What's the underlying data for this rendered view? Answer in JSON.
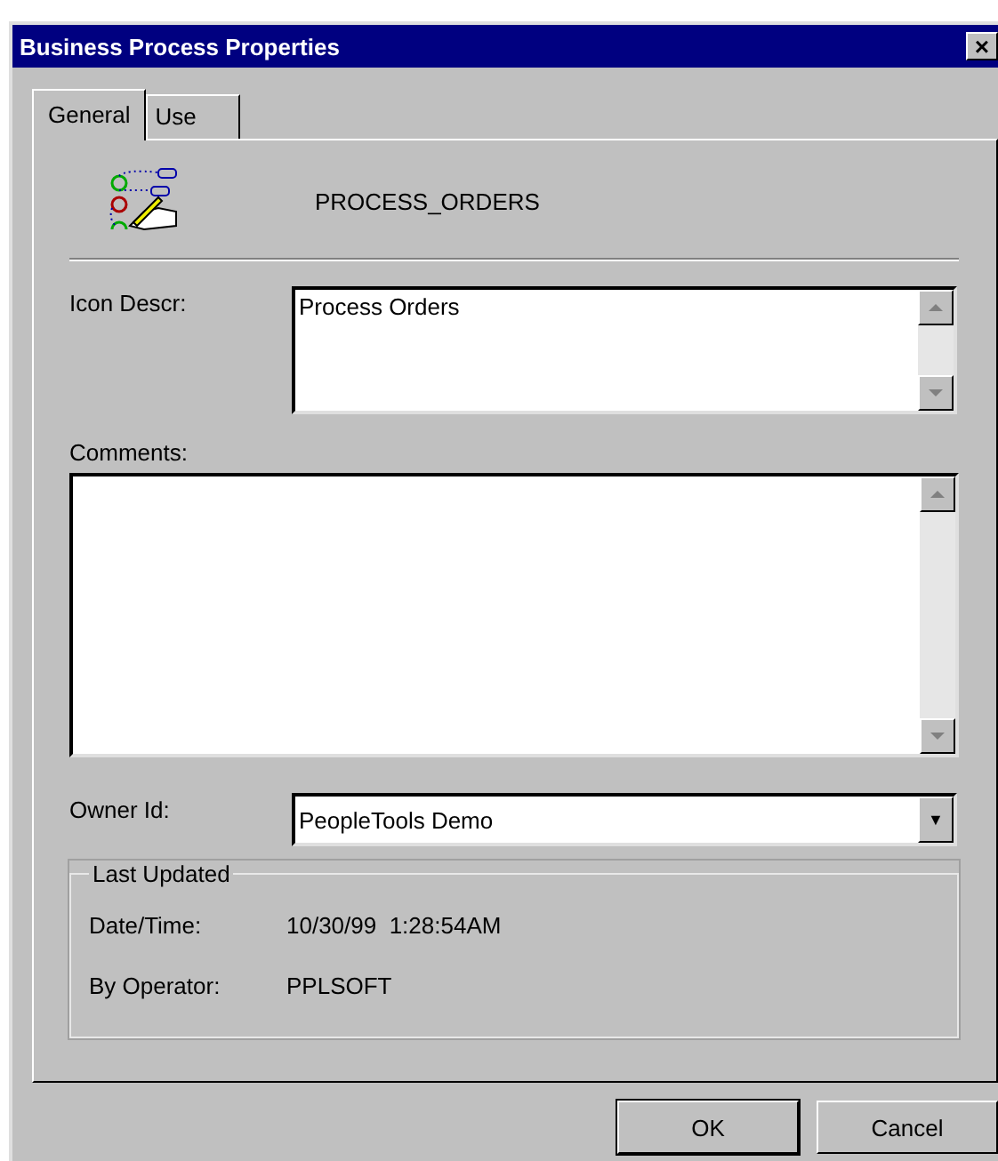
{
  "window": {
    "title": "Business Process Properties",
    "close": "×"
  },
  "tabs": [
    {
      "label": "General",
      "selected": true
    },
    {
      "label": "Use",
      "selected": false
    }
  ],
  "header": {
    "name": "PROCESS_ORDERS"
  },
  "icon_descr": {
    "label": "Icon Descr:",
    "value": "Process Orders"
  },
  "comments": {
    "label": "Comments:"
  },
  "owner_id": {
    "label": "Owner Id:",
    "value": "PeopleTools Demo",
    "arrow": "▼"
  },
  "last_updated": {
    "title": "Last Updated",
    "rows": [
      {
        "label": "Date/Time:",
        "value": "10/30/99  1:28:54AM"
      },
      {
        "label": "By Operator:",
        "value": "PPLSOFT"
      }
    ]
  },
  "buttons": [
    {
      "label": "OK",
      "default": true
    },
    {
      "label": "Cancel",
      "default": false
    }
  ]
}
